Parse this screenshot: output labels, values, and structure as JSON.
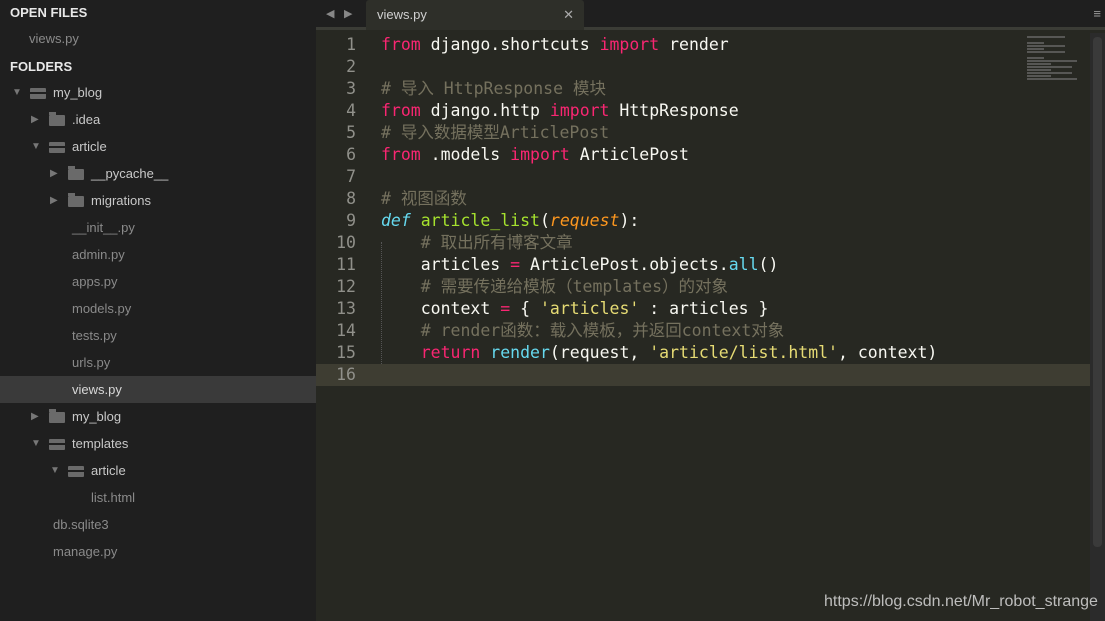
{
  "sidebar": {
    "open_files_title": "OPEN FILES",
    "open_files": [
      "views.py"
    ],
    "folders_title": "FOLDERS",
    "tree": [
      {
        "name": "my_blog",
        "depth": 0,
        "type": "folder",
        "expanded": true
      },
      {
        "name": ".idea",
        "depth": 1,
        "type": "folder",
        "expanded": false
      },
      {
        "name": "article",
        "depth": 1,
        "type": "folder",
        "expanded": true
      },
      {
        "name": "__pycache__",
        "depth": 2,
        "type": "folder",
        "expanded": false
      },
      {
        "name": "migrations",
        "depth": 2,
        "type": "folder",
        "expanded": false
      },
      {
        "name": "__init__.py",
        "depth": 2,
        "type": "file"
      },
      {
        "name": "admin.py",
        "depth": 2,
        "type": "file"
      },
      {
        "name": "apps.py",
        "depth": 2,
        "type": "file"
      },
      {
        "name": "models.py",
        "depth": 2,
        "type": "file"
      },
      {
        "name": "tests.py",
        "depth": 2,
        "type": "file"
      },
      {
        "name": "urls.py",
        "depth": 2,
        "type": "file"
      },
      {
        "name": "views.py",
        "depth": 2,
        "type": "file",
        "selected": true
      },
      {
        "name": "my_blog",
        "depth": 1,
        "type": "folder",
        "expanded": false
      },
      {
        "name": "templates",
        "depth": 1,
        "type": "folder",
        "expanded": true
      },
      {
        "name": "article",
        "depth": 2,
        "type": "folder",
        "expanded": true
      },
      {
        "name": "list.html",
        "depth": 3,
        "type": "file"
      },
      {
        "name": "db.sqlite3",
        "depth": 1,
        "type": "file"
      },
      {
        "name": "manage.py",
        "depth": 1,
        "type": "file"
      }
    ]
  },
  "tabbar": {
    "prev": "◀",
    "next": "▶",
    "tab_label": "views.py",
    "close": "✕",
    "menu": "≡"
  },
  "editor": {
    "current_line": 16,
    "lines": [
      [
        [
          "kw",
          "from"
        ],
        [
          "tx",
          " django.shortcuts "
        ],
        [
          "kw",
          "import"
        ],
        [
          "tx",
          " render"
        ]
      ],
      [],
      [
        [
          "cm",
          "# 导入 HttpResponse 模块"
        ]
      ],
      [
        [
          "kw",
          "from"
        ],
        [
          "tx",
          " django.http "
        ],
        [
          "kw",
          "import"
        ],
        [
          "tx",
          " HttpResponse"
        ]
      ],
      [
        [
          "cm",
          "# 导入数据模型ArticlePost"
        ]
      ],
      [
        [
          "kw",
          "from"
        ],
        [
          "tx",
          " .models "
        ],
        [
          "kw",
          "import"
        ],
        [
          "tx",
          " ArticlePost"
        ]
      ],
      [],
      [
        [
          "cm",
          "# 视图函数"
        ]
      ],
      [
        [
          "df",
          "def"
        ],
        [
          "tx",
          " "
        ],
        [
          "fn",
          "article_list"
        ],
        [
          "tx",
          "("
        ],
        [
          "pa",
          "request"
        ],
        [
          "tx",
          "):"
        ]
      ],
      [
        [
          "tx",
          "    "
        ],
        [
          "cm",
          "# 取出所有博客文章"
        ]
      ],
      [
        [
          "tx",
          "    articles "
        ],
        [
          "kw",
          "="
        ],
        [
          "tx",
          " ArticlePost.objects."
        ],
        [
          "bi",
          "all"
        ],
        [
          "tx",
          "()"
        ]
      ],
      [
        [
          "tx",
          "    "
        ],
        [
          "cm",
          "# 需要传递给模板（templates）的对象"
        ]
      ],
      [
        [
          "tx",
          "    context "
        ],
        [
          "kw",
          "="
        ],
        [
          "tx",
          " { "
        ],
        [
          "st",
          "'articles'"
        ],
        [
          "tx",
          " : articles }"
        ]
      ],
      [
        [
          "tx",
          "    "
        ],
        [
          "cm",
          "# render函数：载入模板，并返回context对象"
        ]
      ],
      [
        [
          "tx",
          "    "
        ],
        [
          "kw",
          "return"
        ],
        [
          "tx",
          " "
        ],
        [
          "bi",
          "render"
        ],
        [
          "tx",
          "(request, "
        ],
        [
          "st",
          "'article/list.html'"
        ],
        [
          "tx",
          ", context)"
        ]
      ],
      []
    ]
  },
  "watermark": "https://blog.csdn.net/Mr_robot_strange"
}
